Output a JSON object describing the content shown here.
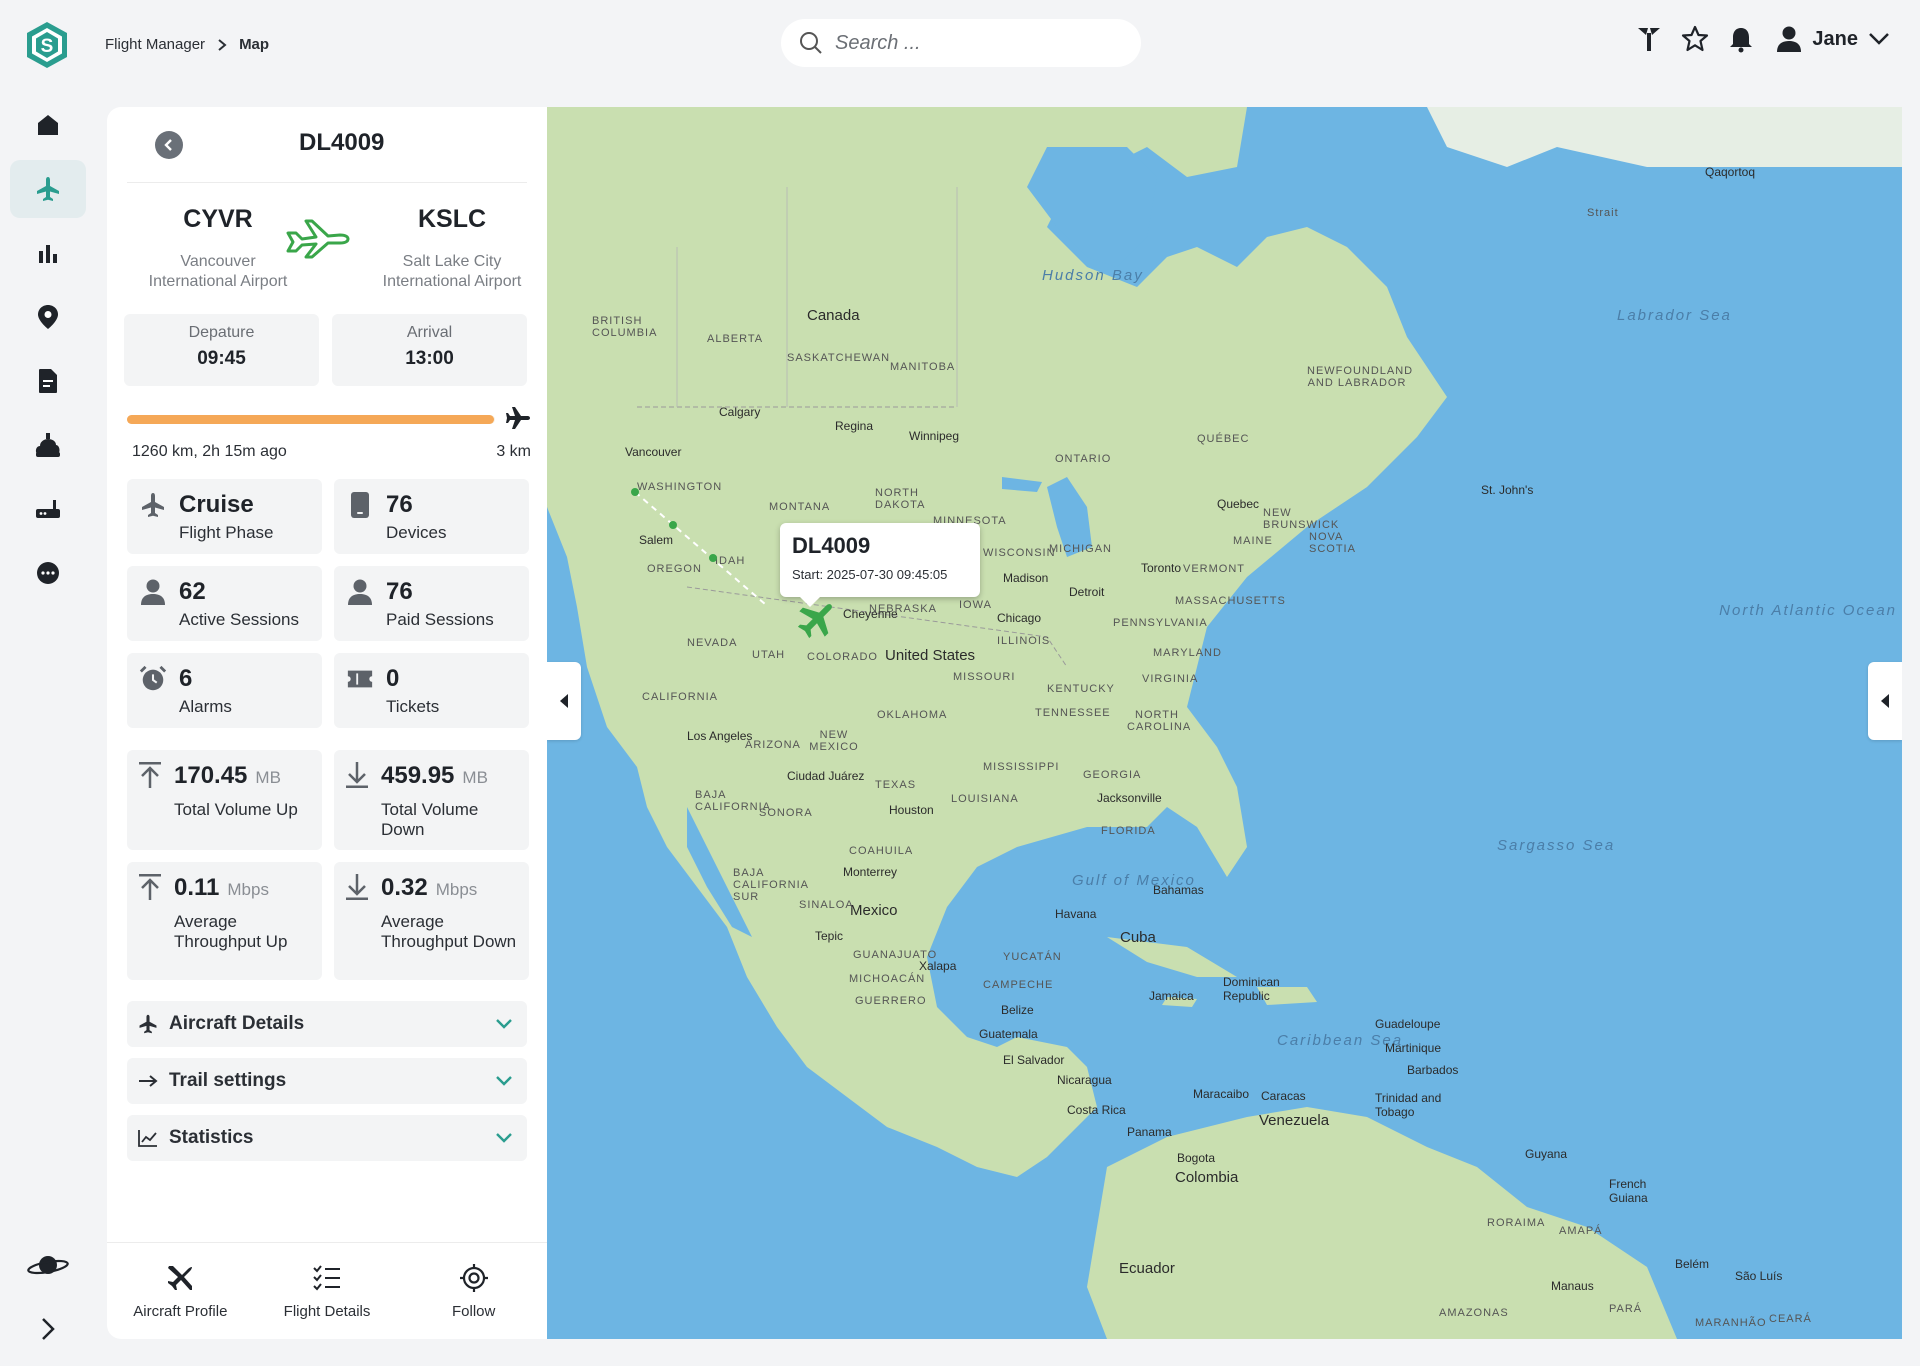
{
  "breadcrumb": {
    "root": "Flight Manager",
    "current": "Map"
  },
  "search": {
    "placeholder": "Search ..."
  },
  "user": {
    "name": "Jane"
  },
  "flight": {
    "id": "DL4009",
    "departure": {
      "code": "CYVR",
      "city": "Vancouver",
      "airport": "International Airport"
    },
    "arrival": {
      "code": "KSLC",
      "city": "Salt Lake City",
      "airport": "International Airport"
    },
    "departure_time": {
      "label": "Depature",
      "value": "09:45"
    },
    "arrival_time": {
      "label": "Arrival",
      "value": "13:00"
    },
    "progress": {
      "fraction": 0.998,
      "flown": "1260 km, 2h 15m ago",
      "remaining": "3 km"
    }
  },
  "stats": {
    "flight_phase": {
      "value": "Cruise",
      "label": "Flight Phase"
    },
    "devices": {
      "value": "76",
      "label": "Devices"
    },
    "active_sessions": {
      "value": "62",
      "label": "Active Sessions"
    },
    "paid_sessions": {
      "value": "76",
      "label": "Paid Sessions"
    },
    "alarms": {
      "value": "6",
      "label": "Alarms"
    },
    "tickets": {
      "value": "0",
      "label": "Tickets"
    },
    "volume_up": {
      "value": "170.45",
      "unit": "MB",
      "label": "Total Volume Up"
    },
    "volume_down": {
      "value": "459.95",
      "unit": "MB",
      "label": "Total Volume Down"
    },
    "throughput_up": {
      "value": "0.11",
      "unit": "Mbps",
      "label": "Average Throughput Up"
    },
    "throughput_down": {
      "value": "0.32",
      "unit": "Mbps",
      "label": "Average Throughput Down"
    }
  },
  "accordions": [
    {
      "label": "Aircraft Details",
      "icon": "plane-icon"
    },
    {
      "label": "Trail settings",
      "icon": "arrow-right-icon"
    },
    {
      "label": "Statistics",
      "icon": "chart-line-icon"
    }
  ],
  "footer": {
    "aircraft_profile": "Aircraft Profile",
    "flight_details": "Flight Details",
    "follow": "Follow"
  },
  "map": {
    "popup": {
      "title": "DL4009",
      "start": "Start: 2025-07-30 09:45:05"
    },
    "labels": {
      "hudson_bay": "Hudson Bay",
      "canada": "Canada",
      "united_states": "United States",
      "mexico": "Mexico",
      "cuba": "Cuba",
      "venezuela": "Venezuela",
      "colombia": "Colombia",
      "ecuador": "Ecuador",
      "gulf_of_mexico": "Gulf of Mexico",
      "caribbean_sea": "Caribbean Sea",
      "north_atlantic": "North Atlantic Ocean",
      "sargasso": "Sargasso Sea",
      "british_columbia": "BRITISH COLUMBIA",
      "alberta": "ALBERTA",
      "saskatchewan": "SASKATCHEWAN",
      "manitoba": "MANITOBA",
      "ontario": "ONTARIO",
      "quebec": "QUÉBEC",
      "newfoundland": "NEWFOUNDLAND AND LABRADOR",
      "washington": "WASHINGTON",
      "oregon": "OREGON",
      "idaho": "IDAH",
      "montana": "MONTANA",
      "north_dakota": "NORTH DAKOTA",
      "minnesota": "MINNESOTA",
      "wisconsin": "WISCONSIN",
      "michigan": "MICHIGAN",
      "nevada": "NEVADA",
      "utah": "UTAH",
      "colorado": "COLORADO",
      "nebraska": "NEBRASKA",
      "iowa": "IOWA",
      "illinois": "ILLINOIS",
      "california": "CALIFORNIA",
      "arizona": "ARIZONA",
      "new_mexico": "NEW MEXICO",
      "oklahoma": "OKLAHOMA",
      "texas": "TEXAS",
      "missouri": "MISSOURI",
      "kentucky": "KENTUCKY",
      "tennessee": "TENNESSEE",
      "mississippi": "MISSISSIPPI",
      "louisiana": "LOUISIANA",
      "georgia": "GEORGIA",
      "florida": "FLORIDA",
      "north_carolina": "NORTH CAROLINA",
      "virginia": "VIRGINIA",
      "maryland": "MARYLAND",
      "pennsylvania": "PENNSYLVANIA",
      "massachusetts": "MASSACHUSETTS",
      "vermont": "VERMONT",
      "maine": "MAINE",
      "new_brunswick": "NEW BRUNSWICK",
      "nova_scotia": "NOVA SCOTIA",
      "baja_california": "BAJA CALIFORNIA",
      "baja_california_sur": "BAJA CALIFORNIA SUR",
      "sonora": "SONORA",
      "coahuila": "COAHUILA",
      "sinaloa": "SINALOA",
      "guanajuato": "GUANAJUATO",
      "michoacan": "MICHOACÁN",
      "guerrero": "GUERRERO",
      "campeche": "CAMPECHE",
      "yucatan": "YUCATÁN",
      "amapa": "AMAPÁ",
      "roraima": "RORAIMA",
      "amazonas": "AMAZONAS",
      "para": "PARÁ",
      "maranhao": "MARANHÃO",
      "ceara": "CEARÁ",
      "labrador_sea": "Labrador Sea",
      "strait": "Strait"
    },
    "cities": {
      "vancouver": "Vancouver",
      "calgary": "Calgary",
      "regina": "Regina",
      "winnipeg": "Winnipeg",
      "salem": "Salem",
      "cheyenne": "Cheyenne",
      "madison": "Madison",
      "chicago": "Chicago",
      "detroit": "Detroit",
      "toronto": "Toronto",
      "quebec": "Quebec",
      "st_johns": "St. John's",
      "qaqortoq": "Qaqortoq",
      "los_angeles": "Los Angeles",
      "ciudad_juarez": "Ciudad Juárez",
      "houston": "Houston",
      "jacksonville": "Jacksonville",
      "monterrey": "Monterrey",
      "tepic": "Tepic",
      "xalapa": "Xalapa",
      "havana": "Havana",
      "bahamas": "Bahamas",
      "belize": "Belize",
      "guatemala": "Guatemala",
      "el_salvador": "El Salvador",
      "nicaragua": "Nicaragua",
      "costa_rica": "Costa Rica",
      "panama": "Panama",
      "jamaica": "Jamaica",
      "dominican_republic": "Dominican Republic",
      "guadeloupe": "Guadeloupe",
      "martinique": "Martinique",
      "barbados": "Barbados",
      "trinidad": "Trinidad and Tobago",
      "maracaibo": "Maracaibo",
      "caracas": "Caracas",
      "bogota": "Bogota",
      "guyana": "Guyana",
      "french_guiana": "French Guiana",
      "belem": "Belém",
      "sao_luis": "São Luís",
      "manaus": "Manaus"
    }
  },
  "colors": {
    "accent": "#2a9d8f",
    "plane_green": "#3aa64a",
    "progress": "#f5a857",
    "land": "#c9dfb0",
    "water": "#6db5e3"
  }
}
